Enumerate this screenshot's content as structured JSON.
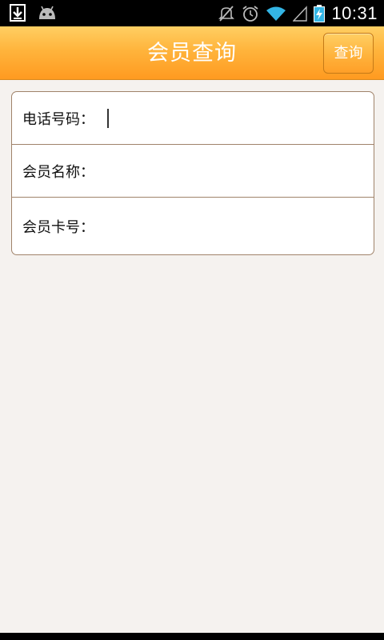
{
  "status_bar": {
    "time": "10:31",
    "left_icons": [
      "download-icon",
      "android-icon"
    ],
    "right_icons": [
      "mute-icon",
      "alarm-icon",
      "wifi-icon",
      "signal-icon",
      "battery-charging-icon"
    ]
  },
  "header": {
    "title": "会员查询",
    "query_button": "查询"
  },
  "form": {
    "phone_label": "电话号码：",
    "phone_value": "",
    "name_label": "会员名称：",
    "name_value": "",
    "card_label": "会员卡号：",
    "card_value": ""
  },
  "colors": {
    "header_orange": "#ffb43c",
    "background": "#f5f2ef",
    "border": "#a0836a"
  }
}
